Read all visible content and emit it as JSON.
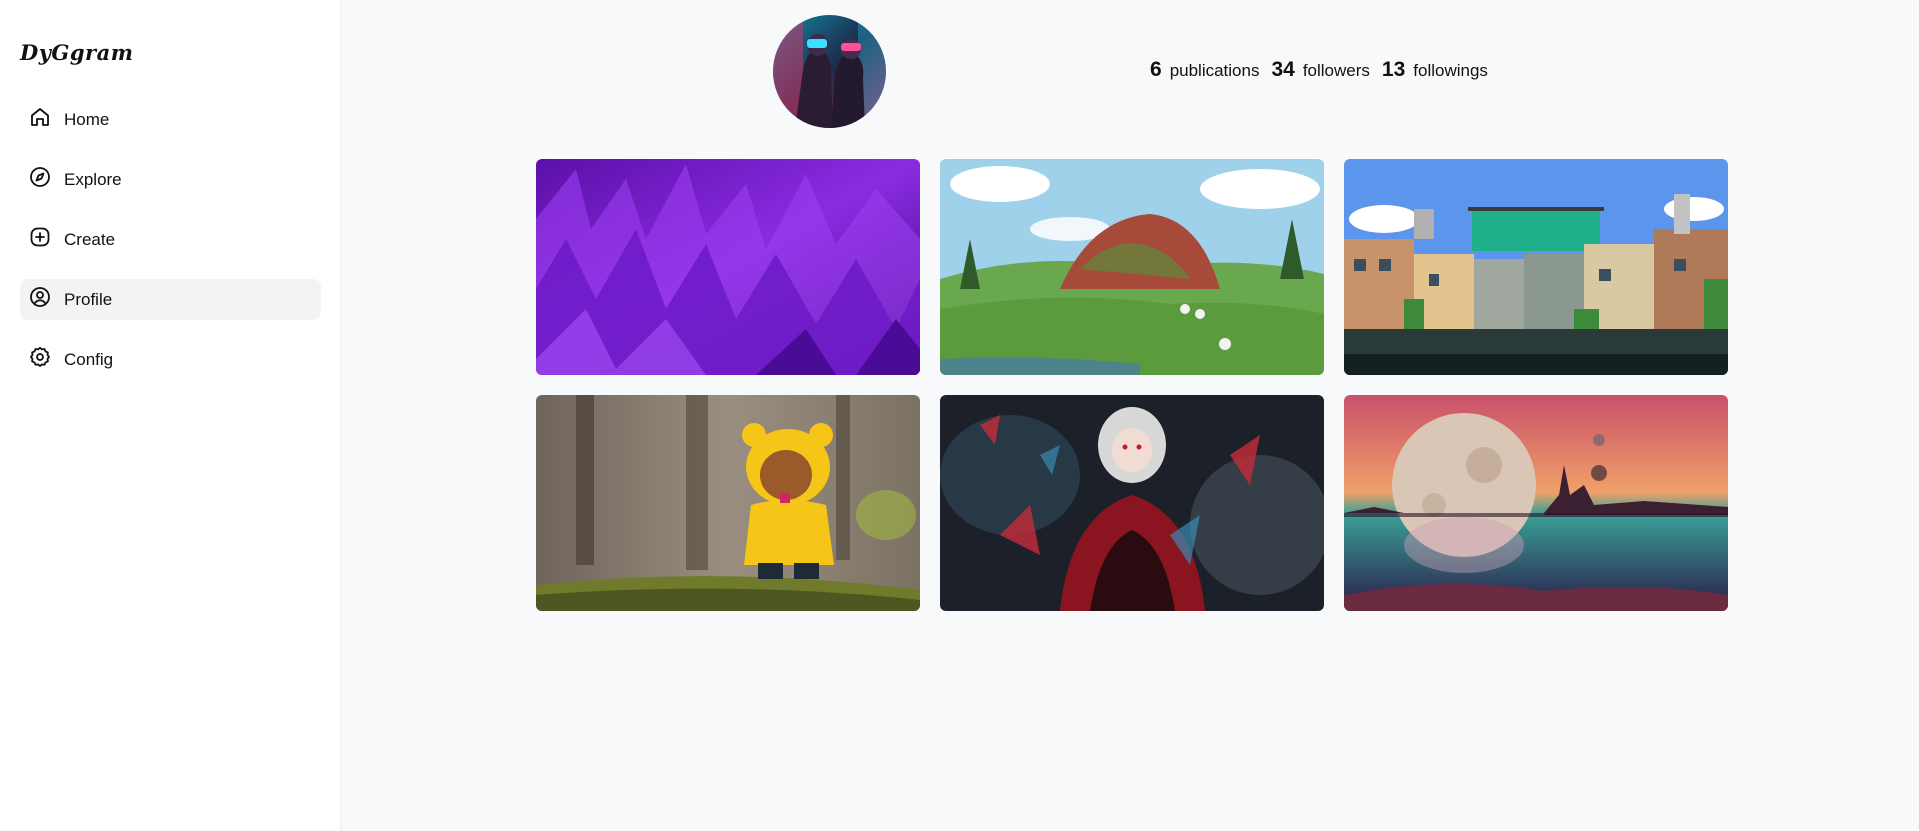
{
  "app": {
    "logo": "DyGgram"
  },
  "sidebar": {
    "items": [
      {
        "label": "Home",
        "icon": "home-icon",
        "active": false
      },
      {
        "label": "Explore",
        "icon": "compass-icon",
        "active": false
      },
      {
        "label": "Create",
        "icon": "plus-square-icon",
        "active": false
      },
      {
        "label": "Profile",
        "icon": "user-circle-icon",
        "active": true
      },
      {
        "label": "Config",
        "icon": "gear-icon",
        "active": false
      }
    ]
  },
  "profile": {
    "stats": [
      {
        "value": "6",
        "label": "publications"
      },
      {
        "value": "34",
        "label": "followers"
      },
      {
        "value": "13",
        "label": "followings"
      }
    ]
  },
  "posts": [
    {
      "subject": "purple abstract spikes"
    },
    {
      "subject": "grassy hill with rock ruins and sheep"
    },
    {
      "subject": "pixel-art city with billboard"
    },
    {
      "subject": "yellow raincoat teddy bear in forest"
    },
    {
      "subject": "anime girl in red and black dress"
    },
    {
      "subject": "planet over reflective alien lake"
    }
  ],
  "colors": {
    "active_nav_bg": "#f2f3f5",
    "page_bg": "#f8f9fb"
  }
}
